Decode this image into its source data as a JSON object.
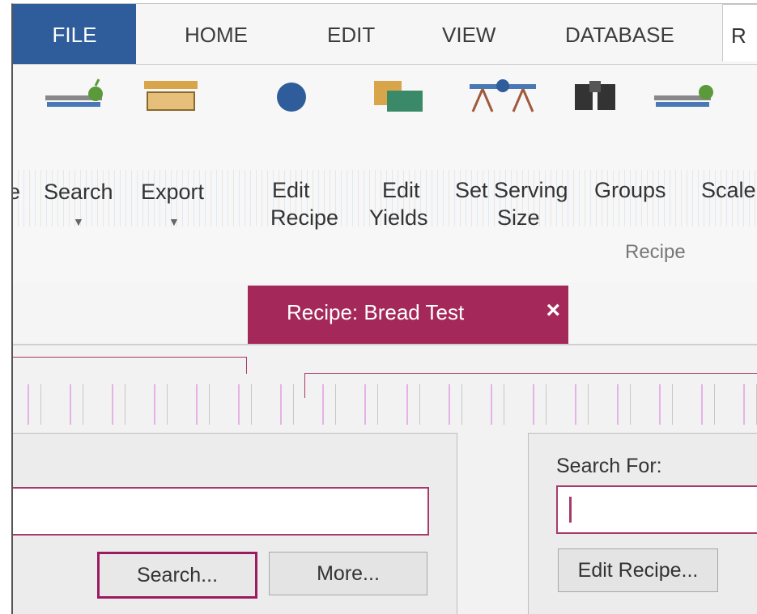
{
  "menu": {
    "file": "FILE",
    "home": "HOME",
    "edit": "EDIT",
    "view": "VIEW",
    "database": "DATABASE",
    "partial_tab": "R"
  },
  "ribbon": {
    "buttons": [
      {
        "label_line1": "e",
        "label_line2": ""
      },
      {
        "label_line1": "Search",
        "label_line2": ""
      },
      {
        "label_line1": "Export",
        "label_line2": ""
      },
      {
        "label_line1": "Edit",
        "label_line2": "Recipe"
      },
      {
        "label_line1": "Edit",
        "label_line2": "Yields"
      },
      {
        "label_line1": "Set Serving",
        "label_line2": "Size"
      },
      {
        "label_line1": "Groups",
        "label_line2": ""
      },
      {
        "label_line1": "Scale",
        "label_line2": ""
      }
    ],
    "group_label": "Recipe"
  },
  "document_tab": {
    "title": "Recipe: Bread Test",
    "close_glyph": "×"
  },
  "left_panel": {
    "search_value": "",
    "search_button": "Search...",
    "more_button": "More..."
  },
  "right_panel": {
    "search_for_label": "Search For:",
    "search_value": "",
    "edit_recipe_button": "Edit Recipe..."
  },
  "colors": {
    "file_tab": "#2f5d9b",
    "accent": "#a4295a",
    "border_accent": "#a83a6a"
  }
}
